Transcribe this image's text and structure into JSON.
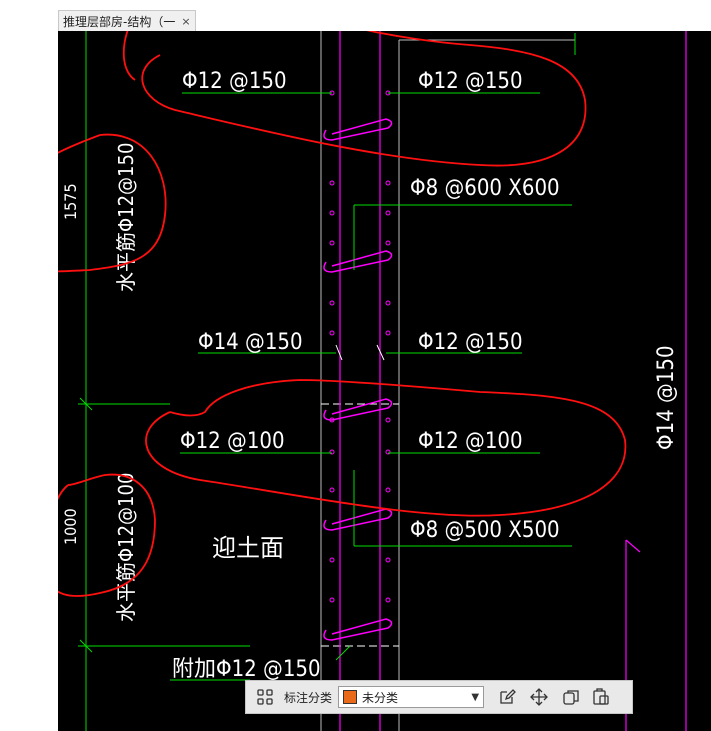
{
  "tab": {
    "title": "推理层部房-结构（一",
    "close": "×"
  },
  "drawing": {
    "labels": {
      "top_left": "Φ12 @150",
      "top_right": "Φ12 @150",
      "tie_upper": "Φ8 @600 X600",
      "mid_left": "Φ14 @150",
      "mid_right": "Φ12 @150",
      "lower_left": "Φ12 @100",
      "lower_right": "Φ12 @100",
      "tie_lower": "Φ8 @500 X500",
      "right_vertical": "Φ14 @150",
      "horiz_upper": "水平筋Φ12@150",
      "dim_upper": "1575",
      "horiz_lower": "水平筋Φ12@100",
      "dim_lower": "1000",
      "soil_face": "迎土面",
      "additional": "附加Φ12 @150"
    },
    "colors": {
      "rebar_line": "#00dd00",
      "wall": "#ff00ff",
      "annotation": "#ff0000",
      "text": "#ffffff"
    }
  },
  "toolbar": {
    "label": "标注分类",
    "select_value": "未分类",
    "select_color": "#e86a1a"
  }
}
